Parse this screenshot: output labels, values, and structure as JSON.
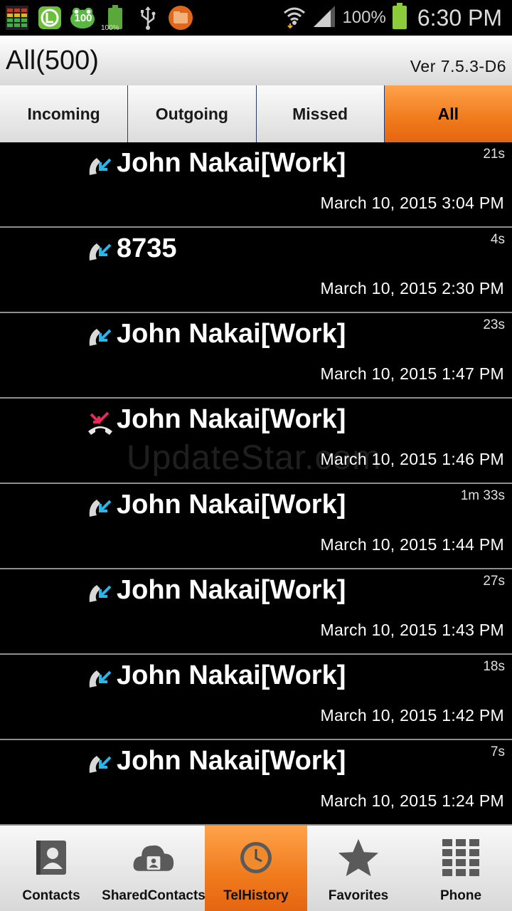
{
  "status_bar": {
    "left_icons": [
      "signal-meter-icon",
      "line-app-icon",
      "frog-100-icon",
      "battery-100-icon",
      "usb-icon",
      "folder-app-icon"
    ],
    "frog_badge": "100",
    "small_battery_text": "100%",
    "battery_percent": "100%",
    "time": "6:30 PM"
  },
  "header": {
    "title": "All(500)",
    "version": "Ver  7.5.3-D6"
  },
  "tabs": [
    {
      "label": "Incoming",
      "active": false
    },
    {
      "label": "Outgoing",
      "active": false
    },
    {
      "label": "Missed",
      "active": false
    },
    {
      "label": "All",
      "active": true
    }
  ],
  "calls": [
    {
      "name": "John Nakai[Work]",
      "duration": "21s",
      "datetime": "March 10, 2015 3:04 PM",
      "type": "incoming"
    },
    {
      "name": "8735",
      "duration": "4s",
      "datetime": "March 10, 2015 2:30 PM",
      "type": "incoming"
    },
    {
      "name": "John Nakai[Work]",
      "duration": "23s",
      "datetime": "March 10, 2015 1:47 PM",
      "type": "incoming"
    },
    {
      "name": "John Nakai[Work]",
      "duration": "",
      "datetime": "March 10, 2015 1:46 PM",
      "type": "missed"
    },
    {
      "name": "John Nakai[Work]",
      "duration": "1m 33s",
      "datetime": "March 10, 2015 1:44 PM",
      "type": "incoming"
    },
    {
      "name": "John Nakai[Work]",
      "duration": "27s",
      "datetime": "March 10, 2015 1:43 PM",
      "type": "incoming"
    },
    {
      "name": "John Nakai[Work]",
      "duration": "18s",
      "datetime": "March 10, 2015 1:42 PM",
      "type": "incoming"
    },
    {
      "name": "John Nakai[Work]",
      "duration": "7s",
      "datetime": "March 10, 2015 1:24 PM",
      "type": "incoming"
    }
  ],
  "watermark": "UpdateStar.com",
  "bottom_nav": [
    {
      "label": "Contacts",
      "icon": "contacts-icon",
      "active": false
    },
    {
      "label": "SharedContacts",
      "icon": "shared-contacts-icon",
      "active": false
    },
    {
      "label": "TelHistory",
      "icon": "clock-icon",
      "active": true
    },
    {
      "label": "Favorites",
      "icon": "star-icon",
      "active": false
    },
    {
      "label": "Phone",
      "icon": "dialpad-icon",
      "active": false
    }
  ],
  "colors": {
    "accent_orange": "#f07a1c",
    "incoming_icon": "#2bb6e8",
    "missed_icon": "#e8285a"
  }
}
